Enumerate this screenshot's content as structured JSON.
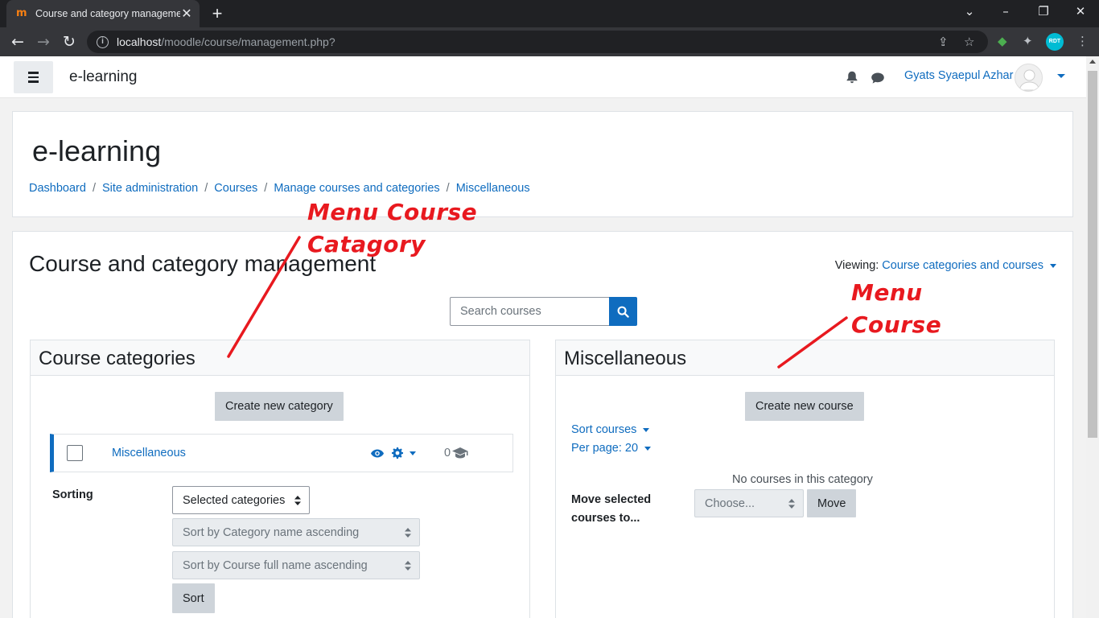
{
  "browser": {
    "tab_title": "Course and category management",
    "tab_close": "✕",
    "new_tab": "+",
    "url_host": "localhost",
    "url_path": "/moodle/course/management.php?",
    "profile_label": "RDT"
  },
  "navbar": {
    "brand": "e-learning",
    "username": "Gyats Syaepul Azhar"
  },
  "header": {
    "title": "e-learning",
    "breadcrumb": [
      "Dashboard",
      "Site administration",
      "Courses",
      "Manage courses and categories",
      "Miscellaneous"
    ],
    "separator": "/"
  },
  "main": {
    "title": "Course and category management",
    "viewing_label": "Viewing:",
    "viewing_value": "Course categories and courses",
    "search_placeholder": "Search courses"
  },
  "categories_panel": {
    "title": "Course categories",
    "create_button": "Create new category",
    "category": {
      "name": "Miscellaneous",
      "course_count": "0"
    },
    "sorting_label": "Sorting",
    "sort_target": "Selected categories",
    "sort_category_option": "Sort by Category name ascending",
    "sort_course_option": "Sort by Course full name ascending",
    "sort_button": "Sort"
  },
  "courses_panel": {
    "title": "Miscellaneous",
    "create_button": "Create new course",
    "sort_courses": "Sort courses",
    "per_page": "Per page: 20",
    "empty_message": "No courses in this category",
    "move_label": "Move selected courses to...",
    "move_select": "Choose...",
    "move_button": "Move"
  },
  "annotations": {
    "left_line1": "Menu Course",
    "left_line2": "Catagory",
    "right_line1": "Menu",
    "right_line2": "Course"
  },
  "colors": {
    "link": "#0f6cbf",
    "annotation": "#e8191f",
    "chrome_dark": "#202124"
  }
}
